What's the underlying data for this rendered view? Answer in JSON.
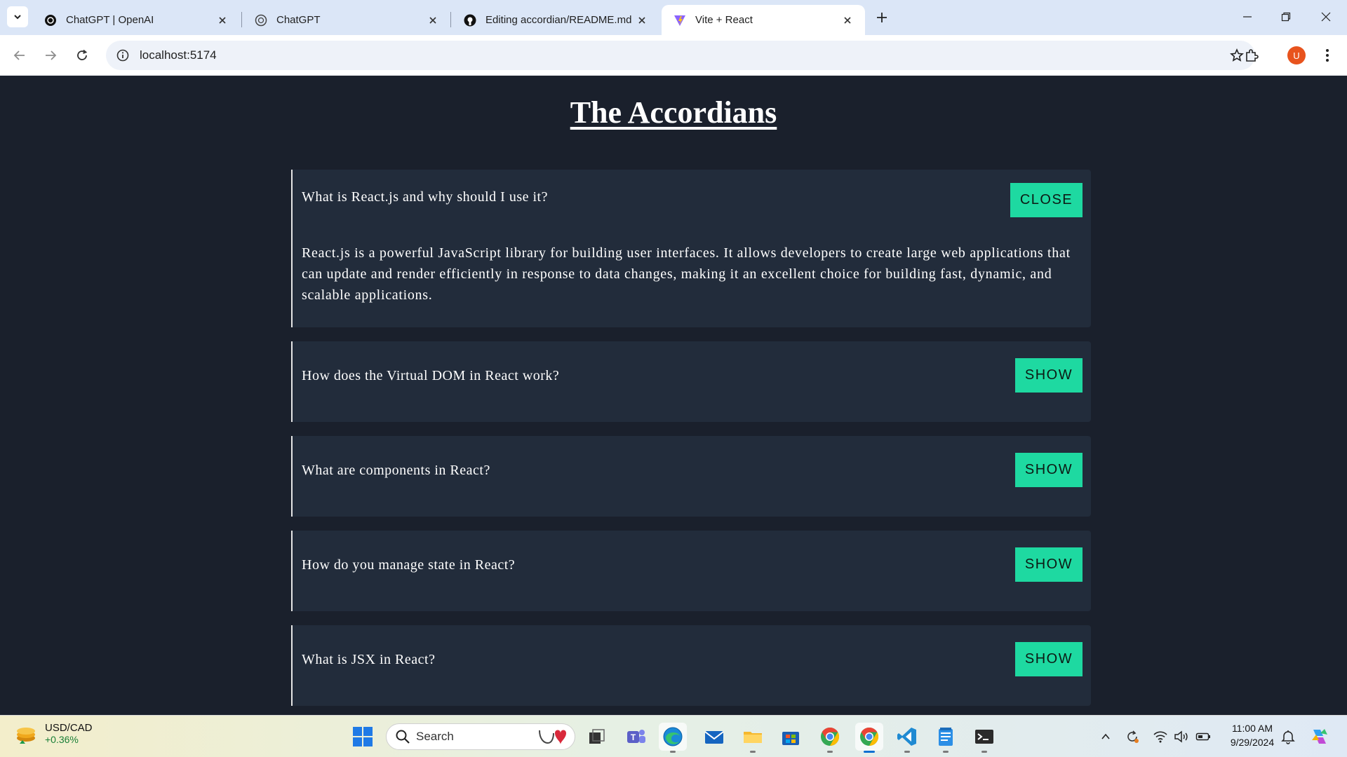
{
  "browser": {
    "tabs": [
      {
        "title": "ChatGPT | OpenAI"
      },
      {
        "title": "ChatGPT"
      },
      {
        "title": "Editing accordian/README.md"
      },
      {
        "title": "Vite + React"
      }
    ],
    "active_tab": 3,
    "url": "localhost:5174",
    "profile_initial": "U"
  },
  "page": {
    "title": "The Accordians",
    "items": [
      {
        "question": "What is React.js and why should I use it?",
        "button_label": "CLOSE",
        "expanded": true,
        "answer": "React.js is a powerful JavaScript library for building user interfaces. It allows developers to create large web applications that can update and render efficiently in response to data changes, making it an excellent choice for building fast, dynamic, and scalable applications."
      },
      {
        "question": "How does the Virtual DOM in React work?",
        "button_label": "SHOW",
        "expanded": false
      },
      {
        "question": "What are components in React?",
        "button_label": "SHOW",
        "expanded": false
      },
      {
        "question": "How do you manage state in React?",
        "button_label": "SHOW",
        "expanded": false
      },
      {
        "question": "What is JSX in React?",
        "button_label": "SHOW",
        "expanded": false
      }
    ]
  },
  "taskbar": {
    "widget": {
      "name": "USD/CAD",
      "value": "+0.36%"
    },
    "search_placeholder": "Search",
    "time": "11:00 AM",
    "date": "9/29/2024"
  },
  "colors": {
    "page_bg": "#1a202c",
    "card_bg": "#222c3b",
    "accent": "#1ed9a1"
  }
}
